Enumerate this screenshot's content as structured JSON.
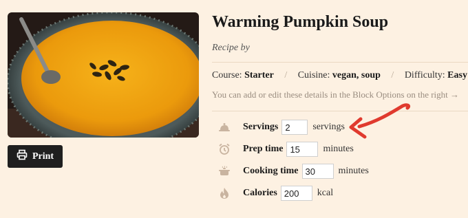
{
  "recipe": {
    "title": "Warming Pumpkin Soup",
    "byline": "Recipe by"
  },
  "meta": {
    "course_label": "Course:",
    "course_value": "Starter",
    "cuisine_label": "Cuisine:",
    "cuisine_value": "vegan, soup",
    "difficulty_label": "Difficulty:",
    "difficulty_value": "Easy",
    "separator": "/",
    "hint": "You can add or edit these details in the Block Options on the right →"
  },
  "actions": {
    "print_label": "Print",
    "print_icon": "printer-icon"
  },
  "details": [
    {
      "label": "Servings",
      "value": "2",
      "unit": "servings",
      "icon": "servings-icon"
    },
    {
      "label": "Prep time",
      "value": "15",
      "unit": "minutes",
      "icon": "alarm-clock-icon"
    },
    {
      "label": "Cooking time",
      "value": "30",
      "unit": "minutes",
      "icon": "cooking-pot-icon"
    },
    {
      "label": "Calories",
      "value": "200",
      "unit": "kcal",
      "icon": "flame-icon"
    }
  ],
  "colors": {
    "background": "#fdf1e2",
    "arrow": "#e03a2e",
    "button": "#1f1f1f",
    "icon": "#c9b4a0"
  }
}
